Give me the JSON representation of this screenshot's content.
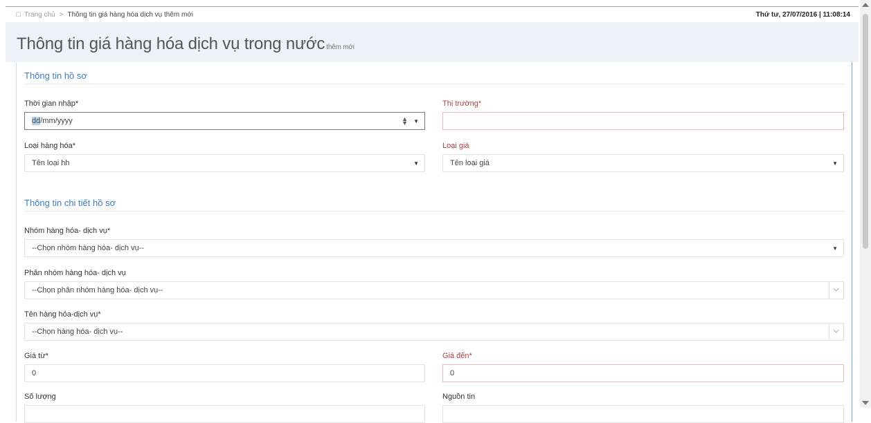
{
  "breadcrumb": {
    "home_label": "Trang chủ",
    "separator": ">",
    "current": "Thông tin giá hàng hóa dịch vụ thêm mới"
  },
  "datetime": "Thứ tư, 27/07/2016 | 11:08:14",
  "page": {
    "title": "Thông tin giá hàng hóa dịch vụ trong nước",
    "subtitle": "thêm mới"
  },
  "section1": {
    "title": "Thông tin hồ sơ",
    "time_label": "Thời gian nhập*",
    "time_value_day": "dd",
    "time_value_rest": "/mm/yyyy",
    "market_label": "Thị trường*",
    "market_value": "",
    "goods_type_label": "Loại hàng hóa*",
    "goods_type_value": "Tên loại hh",
    "price_type_label": "Loại giá",
    "price_type_value": "Tên loại giá"
  },
  "section2": {
    "title": "Thông tin chi tiết hồ sơ",
    "group_label": "Nhóm hàng hóa- dịch vụ*",
    "group_value": "--Chọn nhóm hàng hóa- dịch vụ--",
    "subgroup_label": "Phân nhóm hàng hóa- dịch vụ",
    "subgroup_value": "--Chọn phân nhóm hàng hóa- dịch vụ--",
    "name_label": "Tên hàng hóa-dịch vụ*",
    "name_value": "--Chọn hàng hóa- dịch vụ--",
    "price_from_label": "Giá từ*",
    "price_from_value": "0",
    "price_to_label": "Giá đến*",
    "price_to_value": "0",
    "quantity_label": "Số lượng",
    "source_label": "Nguồn tin"
  },
  "icons": {
    "home": "home-icon",
    "dropdown": "caret-down-icon",
    "chevron": "chevron-down-icon",
    "spinner": "spinner-icon"
  },
  "colors": {
    "accent": "#3b7fc4",
    "error_label": "#a94442",
    "header_bg": "#eef1f7"
  }
}
